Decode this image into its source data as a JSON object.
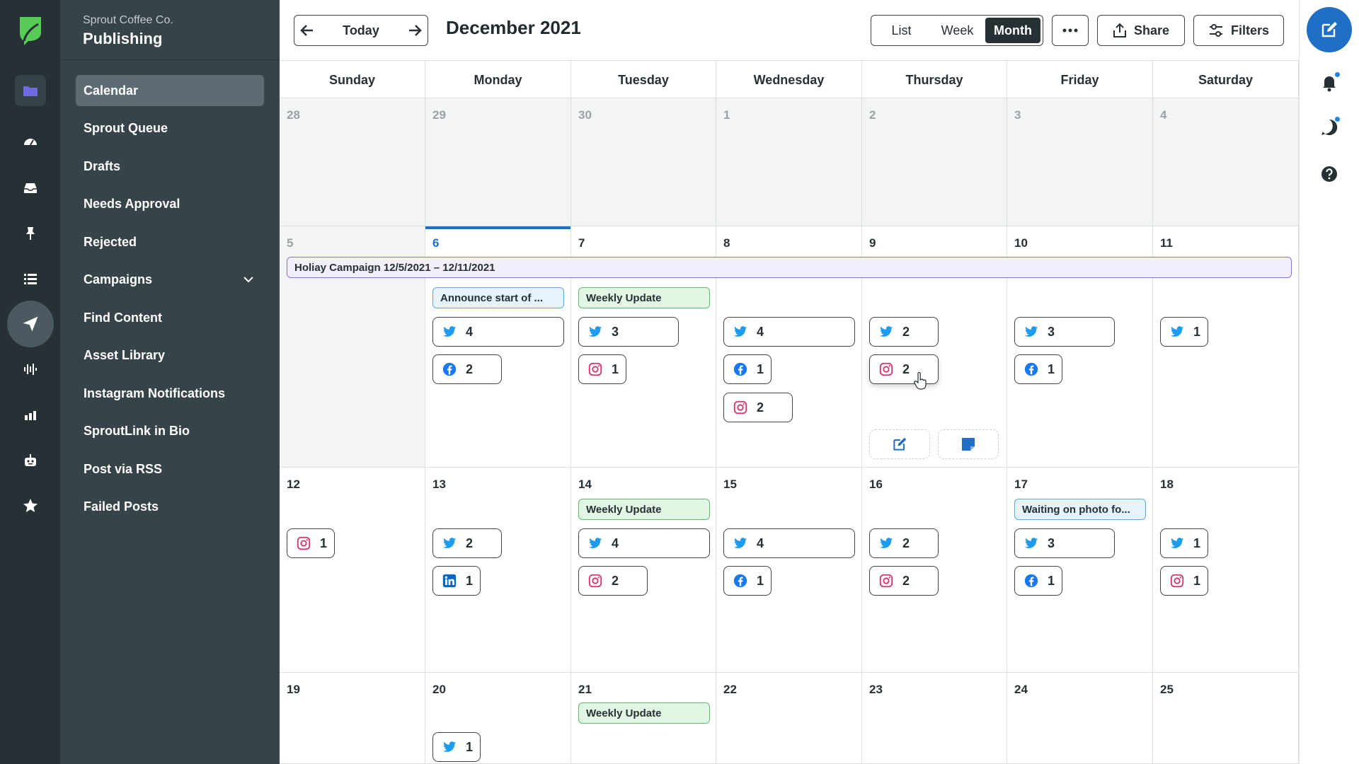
{
  "sidebar": {
    "company": "Sprout Coffee Co.",
    "title": "Publishing",
    "items": [
      {
        "label": "Calendar"
      },
      {
        "label": "Sprout Queue"
      },
      {
        "label": "Drafts"
      },
      {
        "label": "Needs Approval"
      },
      {
        "label": "Rejected"
      },
      {
        "label": "Campaigns"
      },
      {
        "label": "Find Content"
      },
      {
        "label": "Asset Library"
      },
      {
        "label": "Instagram Notifications"
      },
      {
        "label": "SproutLink in Bio"
      },
      {
        "label": "Post via RSS"
      },
      {
        "label": "Failed Posts"
      }
    ]
  },
  "rail_icons": [
    "folder-icon",
    "dashboard-icon",
    "inbox-icon",
    "pin-icon",
    "list-icon",
    "send-icon",
    "listening-icon",
    "reports-icon",
    "bot-icon",
    "star-icon"
  ],
  "toolbar": {
    "today_label": "Today",
    "month_title": "December 2021",
    "views": [
      "List",
      "Week",
      "Month"
    ],
    "active_view": "Month",
    "share_label": "Share",
    "filters_label": "Filters"
  },
  "calendar": {
    "days_of_week": [
      "Sunday",
      "Monday",
      "Tuesday",
      "Wednesday",
      "Thursday",
      "Friday",
      "Saturday"
    ],
    "weeks": [
      [
        "28",
        "29",
        "30",
        "1",
        "2",
        "3",
        "4"
      ],
      [
        "5",
        "6",
        "7",
        "8",
        "9",
        "10",
        "11"
      ],
      [
        "12",
        "13",
        "14",
        "15",
        "16",
        "17",
        "18"
      ],
      [
        "19",
        "20",
        "21",
        "22",
        "23",
        "24",
        "25"
      ]
    ],
    "today": "6",
    "campaign": "Holiay Campaign 12/5/2021 – 12/11/2021",
    "notes": {
      "announce": "Announce start of ...",
      "weekly_update": "Weekly Update",
      "waiting_photo": "Waiting on photo fo..."
    },
    "posts": {
      "mon6_twitter": "4",
      "mon6_facebook": "2",
      "tue7_twitter": "3",
      "tue7_instagram": "1",
      "wed8_twitter": "4",
      "wed8_facebook": "1",
      "wed8_instagram": "2",
      "thu9_twitter": "2",
      "thu9_instagram": "2",
      "fri10_twitter": "3",
      "fri10_facebook": "1",
      "sat11_twitter": "1",
      "sun12_instagram": "1",
      "mon13_twitter": "2",
      "mon13_linkedin": "1",
      "tue14_twitter": "4",
      "tue14_instagram": "2",
      "wed15_twitter": "4",
      "wed15_facebook": "1",
      "thu16_twitter": "2",
      "thu16_instagram": "2",
      "fri17_twitter": "3",
      "fri17_facebook": "1",
      "sat18_twitter": "1",
      "sat18_instagram": "1",
      "mon20_twitter": "1"
    }
  },
  "colors": {
    "rail": "#273135",
    "sidebar": "#364348",
    "accent": "#1f6fc5",
    "twitter": "#1d9bf0",
    "facebook": "#1877f2",
    "instagram": "#d6336c",
    "linkedin": "#0a66c2",
    "campaign_border": "#8c6fd8",
    "note_blue": "#5aa7e8",
    "note_green": "#5cbf6a"
  }
}
